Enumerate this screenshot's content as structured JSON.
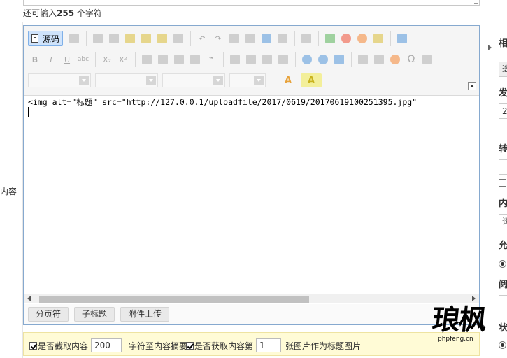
{
  "top_field": {
    "hint_prefix": "还可输入",
    "remaining": "255",
    "hint_suffix": "个字符"
  },
  "field_label": "内容",
  "editor": {
    "source_button_label": "源码",
    "toolbar_row1_icons": [
      "new-doc-icon",
      "cut-icon",
      "copy-icon",
      "paste-icon",
      "paste-text-icon",
      "paste-word-icon",
      "print-icon",
      "undo-icon",
      "redo-icon",
      "find-icon",
      "replace-icon",
      "select-all-icon",
      "remove-format-icon",
      "preview-icon",
      "image-icon",
      "flash-icon",
      "media-icon",
      "video-icon",
      "maximize-icon"
    ],
    "toolbar_row2_icons": [
      "bold-icon",
      "italic-icon",
      "underline-icon",
      "strike-icon",
      "subscript-icon",
      "superscript-icon",
      "ordered-list-icon",
      "unordered-list-icon",
      "outdent-icon",
      "indent-icon",
      "blockquote-icon",
      "align-left-icon",
      "align-center-icon",
      "align-right-icon",
      "justify-icon",
      "link-icon",
      "unlink-icon",
      "anchor-icon",
      "table-icon",
      "horizontal-rule-icon",
      "smiley-icon",
      "special-char-icon",
      "page-break-icon"
    ],
    "toolbar_row2_labels": {
      "bold": "B",
      "italic": "I",
      "underline": "U",
      "strike": "abc",
      "subscript": "X₂",
      "superscript": "X²",
      "blockquote": "❞",
      "special_char": "Ω"
    },
    "toolbar_row3_dropdowns": [
      "",
      "",
      "",
      ""
    ],
    "text_color_label": "A",
    "bg_color_label": "A",
    "source_code": "<img alt=\"标题\" src=\"http://127.0.0.1/uploadfile/2017/0619/20170619100251395.jpg\"",
    "footer_buttons": [
      "分页符",
      "子标题",
      "附件上传"
    ]
  },
  "options_bar": {
    "cut_summary_label": "是否截取内容",
    "cut_summary_checked": true,
    "cut_summary_value": "200",
    "cut_summary_suffix": "字符至内容摘要",
    "get_thumb_label": "是否获取内容第",
    "get_thumb_checked": true,
    "get_thumb_value": "1",
    "get_thumb_suffix": "张图片作为标题图片"
  },
  "sidebar": {
    "labels": [
      "相",
      "发",
      "转",
      "内",
      "允",
      "阅",
      "状"
    ],
    "button_text": "选",
    "date_prefix": "2",
    "content_field_prefix": "请"
  },
  "watermark": {
    "glyphs": "琅枫",
    "site": "phpfeng.cn"
  }
}
